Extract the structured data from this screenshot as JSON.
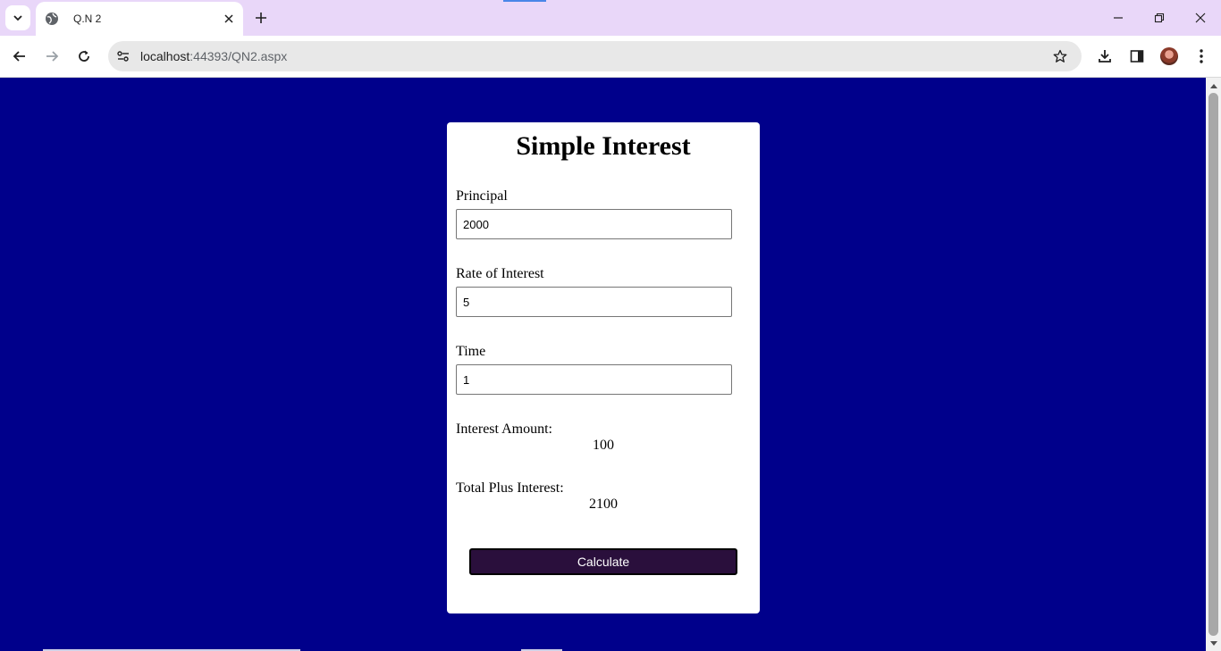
{
  "browser": {
    "tab_title": "Q.N 2",
    "url_host": "localhost",
    "url_rest": ":44393/QN2.aspx"
  },
  "form": {
    "heading": "Simple Interest",
    "principal_label": "Principal",
    "principal_value": "2000",
    "rate_label": "Rate of Interest",
    "rate_value": "5",
    "time_label": "Time",
    "time_value": "1",
    "interest_label": "Interest Amount:",
    "interest_value": "100",
    "total_label": "Total Plus Interest:",
    "total_value": "2100",
    "button_label": "Calculate"
  },
  "colors": {
    "page_background": "#00008b",
    "button_background": "#2a0f3c",
    "tabstrip": "#e9d7f9"
  }
}
